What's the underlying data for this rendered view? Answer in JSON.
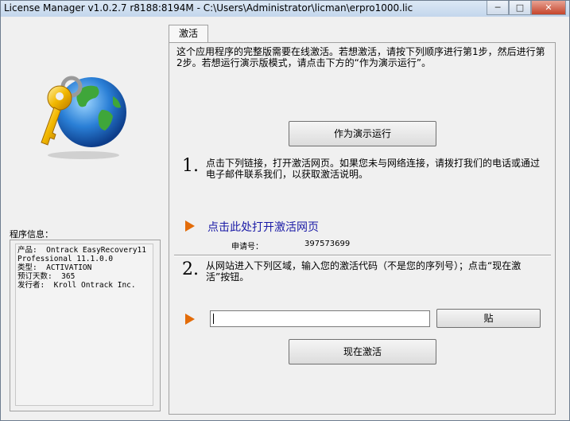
{
  "window": {
    "title": "License Manager v1.0.2.7 r8188:8194M - C:\\Users\\Administrator\\licman\\erpro1000.lic",
    "buttons": {
      "minimize": "─",
      "maximize": "□",
      "close": "✕"
    }
  },
  "left": {
    "info_label": "程序信息：",
    "info_text": "产品:  Ontrack EasyRecovery11\nProfessional 11.1.0.0\n类型:  ACTIVATION\n预订天数:  365\n发行者:  Kroll Ontrack Inc."
  },
  "tab": {
    "label": "激活"
  },
  "panel": {
    "intro": "这个应用程序的完整版需要在线激活。若想激活，请按下列顺序进行第1步，然后进行第2步。若想运行演示版模式，请点击下方的“作为演示运行”。",
    "demo_button": "作为演示运行",
    "step1": {
      "number": "1.",
      "text": "点击下列链接，打开激活网页。如果您未与网络连接，请拨打我们的电话或通过电子邮件联系我们，以获取激活说明。",
      "link": "点击此处打开激活网页",
      "request_label": "申请号：",
      "request_value": "397573699"
    },
    "step2": {
      "number": "2.",
      "text": "从网站进入下列区域，输入您的激活代码（不是您的序列号）；点击“现在激活”按钮。",
      "code_value": "",
      "paste_button": "贴",
      "activate_button": "现在激活"
    }
  },
  "colors": {
    "arrow": "#e36c09",
    "link": "#1a1aa6",
    "panel_bg": "#f0f0f0"
  }
}
